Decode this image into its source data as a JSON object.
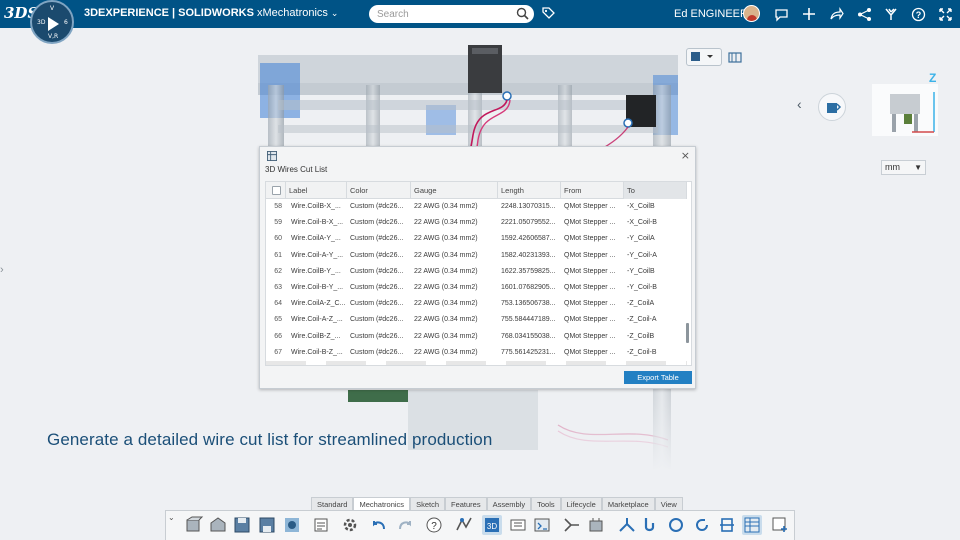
{
  "topbar": {
    "brand_bold": "3DEXPERIENCE | SOLIDWORKS",
    "brand_app": " xMechatronics",
    "search_placeholder": "Search",
    "user_name": "Ed ENGINEER",
    "compass": {
      "top": "V",
      "left": "3D",
      "right": "6",
      "bottom": "V,R"
    }
  },
  "viewer": {
    "unit": "mm",
    "axis_label": "Z"
  },
  "dialog": {
    "title": "3D Wires Cut List",
    "columns": [
      "Label",
      "Color",
      "Gauge",
      "Length",
      "From",
      "To"
    ],
    "rows": [
      {
        "num": "58",
        "label": "Wire.CoilB-X_...",
        "color": "Custom (#dc26...",
        "gauge": "22 AWG (0.34 mm2)",
        "length": "2248.13070315...",
        "from": "QMot Stepper ...",
        "to": "-X_CoilB"
      },
      {
        "num": "59",
        "label": "Wire.Coil-B-X_...",
        "color": "Custom (#dc26...",
        "gauge": "22 AWG (0.34 mm2)",
        "length": "2221.05079552...",
        "from": "QMot Stepper ...",
        "to": "-X_Coil-B"
      },
      {
        "num": "60",
        "label": "Wire.CoilA-Y_...",
        "color": "Custom (#dc26...",
        "gauge": "22 AWG (0.34 mm2)",
        "length": "1592.42606587...",
        "from": "QMot Stepper ...",
        "to": "-Y_CoilA"
      },
      {
        "num": "61",
        "label": "Wire.Coil-A-Y_...",
        "color": "Custom (#dc26...",
        "gauge": "22 AWG (0.34 mm2)",
        "length": "1582.40231393...",
        "from": "QMot Stepper ...",
        "to": "-Y_Coil-A"
      },
      {
        "num": "62",
        "label": "Wire.CoilB-Y_...",
        "color": "Custom (#dc26...",
        "gauge": "22 AWG (0.34 mm2)",
        "length": "1622.35759825...",
        "from": "QMot Stepper ...",
        "to": "-Y_CoilB"
      },
      {
        "num": "63",
        "label": "Wire.Coil-B-Y_...",
        "color": "Custom (#dc26...",
        "gauge": "22 AWG (0.34 mm2)",
        "length": "1601.07682905...",
        "from": "QMot Stepper ...",
        "to": "-Y_Coil-B"
      },
      {
        "num": "64",
        "label": "Wire.CoilA-Z_C...",
        "color": "Custom (#dc26...",
        "gauge": "22 AWG (0.34 mm2)",
        "length": "753.136506738...",
        "from": "QMot Stepper ...",
        "to": "-Z_CoilA"
      },
      {
        "num": "65",
        "label": "Wire.Coil-A-Z_...",
        "color": "Custom (#dc26...",
        "gauge": "22 AWG (0.34 mm2)",
        "length": "755.584447189...",
        "from": "QMot Stepper ...",
        "to": "-Z_Coil-A"
      },
      {
        "num": "66",
        "label": "Wire.CoilB-Z_...",
        "color": "Custom (#dc26...",
        "gauge": "22 AWG (0.34 mm2)",
        "length": "768.034155038...",
        "from": "QMot Stepper ...",
        "to": "-Z_CoilB"
      },
      {
        "num": "67",
        "label": "Wire.Coil-B-Z_...",
        "color": "Custom (#dc26...",
        "gauge": "22 AWG (0.34 mm2)",
        "length": "775.561425231...",
        "from": "QMot Stepper ...",
        "to": "-Z_Coil-B"
      }
    ],
    "export_label": "Export Table",
    "scroll_position": 0.85
  },
  "caption": "Generate a detailed wire cut list for streamlined production",
  "action_bar": {
    "tabs": [
      "Standard",
      "Mechatronics",
      "Sketch",
      "Features",
      "Assembly",
      "Tools",
      "Lifecycle",
      "Marketplace",
      "View"
    ],
    "active_tab": "Mechatronics"
  },
  "colors": {
    "topbar": "#005386",
    "accent": "#2380c3",
    "caption": "#1b4f78",
    "wire": "#c2185b"
  }
}
